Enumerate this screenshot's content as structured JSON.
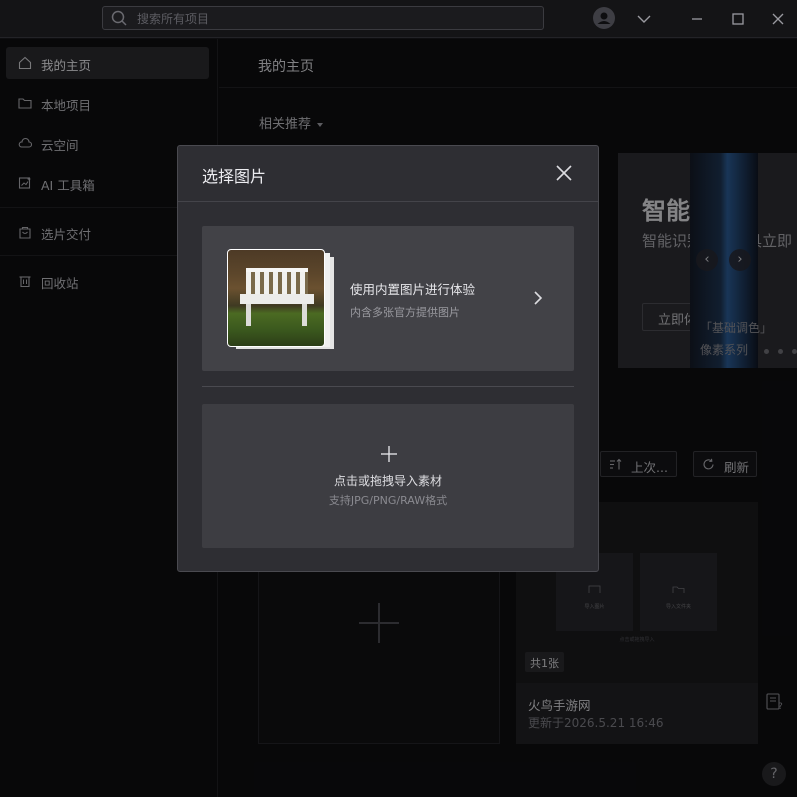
{
  "search": {
    "placeholder": "搜索所有项目"
  },
  "sidebar": {
    "items": [
      {
        "label": "我的主页"
      },
      {
        "label": "本地项目"
      },
      {
        "label": "云空间"
      },
      {
        "label": "AI 工具箱"
      },
      {
        "label": "选片交付"
      },
      {
        "label": "回收站"
      }
    ]
  },
  "main": {
    "title": "我的主页",
    "recommend_label": "相关推荐",
    "banner": {
      "title": "智能修复",
      "description": "智能识别区域，具立即",
      "button_label": "立即体验",
      "caption1": "「基础调色」",
      "caption2": "像素系列"
    },
    "toolbar": {
      "sort_label": "上次...",
      "refresh_label": "刷新"
    },
    "project": {
      "count_badge": "共1张",
      "name": "火鸟手游网",
      "updated": "更新于2026.5.21 16:46",
      "mini_import_image": "导入图片",
      "mini_import_folder": "导入文件夹",
      "mini_note": "点击或拖拽导入"
    }
  },
  "dialog": {
    "title": "选择图片",
    "builtin": {
      "title": "使用内置图片进行体验",
      "subtitle": "内含多张官方提供图片"
    },
    "import": {
      "label": "点击或拖拽导入素材",
      "hint": "支持JPG/PNG/RAW格式"
    }
  },
  "help_label": "?",
  "colors": {
    "background": "#0e0e10",
    "dialog_bg": "#2e2e33",
    "card_bg": "#424247",
    "active_nav": "#2a2a2e"
  }
}
